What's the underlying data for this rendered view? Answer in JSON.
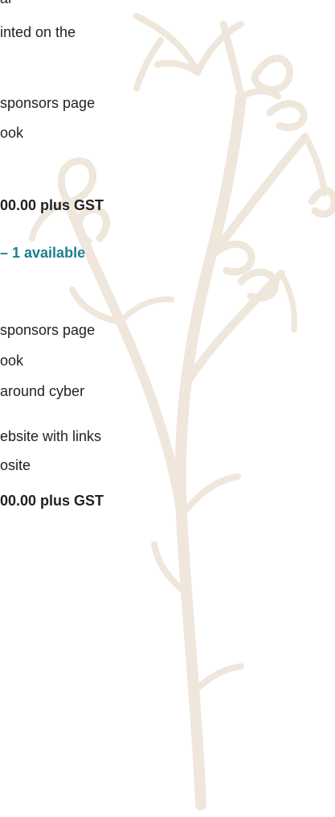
{
  "colors": {
    "text": "#222222",
    "accent": "#1d7f8c",
    "illustration": "#efe6dc"
  },
  "section_a": {
    "lines": [
      "al",
      "inted on the",
      "sponsors page",
      "ook"
    ],
    "price": "00.00 plus GST"
  },
  "section_b": {
    "header": "– 1 available",
    "lines": [
      "sponsors page",
      "ook",
      "around cyber",
      "ebsite with links",
      "osite"
    ],
    "price": "00.00 plus GST"
  },
  "background": {
    "icon": "botanical-sketch-illustration"
  }
}
